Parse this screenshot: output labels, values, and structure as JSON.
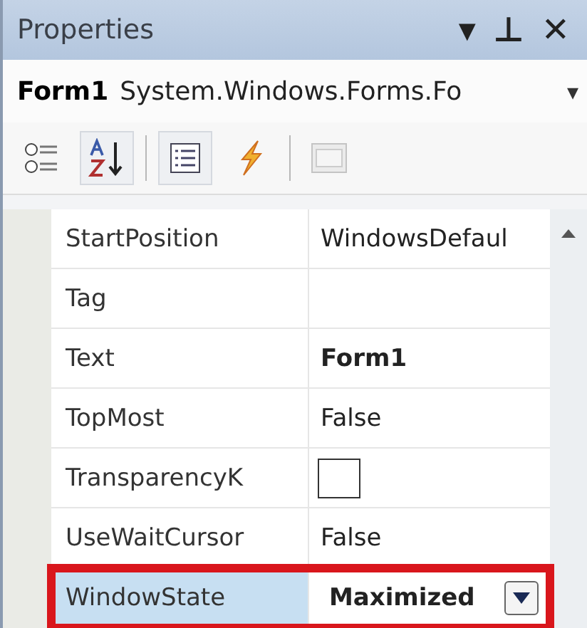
{
  "window": {
    "title": "Properties",
    "buttons": [
      "▾",
      "⊥",
      "✕"
    ]
  },
  "object_selector": {
    "name": "Form1",
    "type": "System.Windows.Forms.Fo",
    "caret": "▾"
  },
  "toolbar": [
    {
      "kind": "categorized",
      "selected": false
    },
    {
      "kind": "alphabetical",
      "selected": true
    },
    {
      "kind": "separator"
    },
    {
      "kind": "properties",
      "selected": true
    },
    {
      "kind": "events",
      "selected": false
    },
    {
      "kind": "separator"
    },
    {
      "kind": "pages",
      "selected": false,
      "disabled": true
    }
  ],
  "properties": [
    {
      "name": "StartPosition",
      "value": "WindowsDefaul",
      "kind": "text",
      "bold": false,
      "selected": false,
      "highlighted": false
    },
    {
      "name": "Tag",
      "kind": "text",
      "selected": false,
      "highlighted": false
    },
    {
      "name": "Text",
      "value": "Form1",
      "kind": "text",
      "bold": true,
      "selected": false,
      "highlighted": false
    },
    {
      "name": "TopMost",
      "value": "False",
      "kind": "text",
      "bold": false,
      "selected": false,
      "highlighted": false
    },
    {
      "name": "TransparencyK",
      "kind": "color",
      "color": "#ffffff",
      "selected": false,
      "highlighted": false
    },
    {
      "name": "UseWaitCursor",
      "value": "False",
      "kind": "text",
      "bold": false,
      "selected": false,
      "highlighted": false
    },
    {
      "name": "WindowState",
      "value": "Maximized",
      "kind": "dropdown",
      "bold": true,
      "selected": true,
      "highlighted": true
    }
  ]
}
